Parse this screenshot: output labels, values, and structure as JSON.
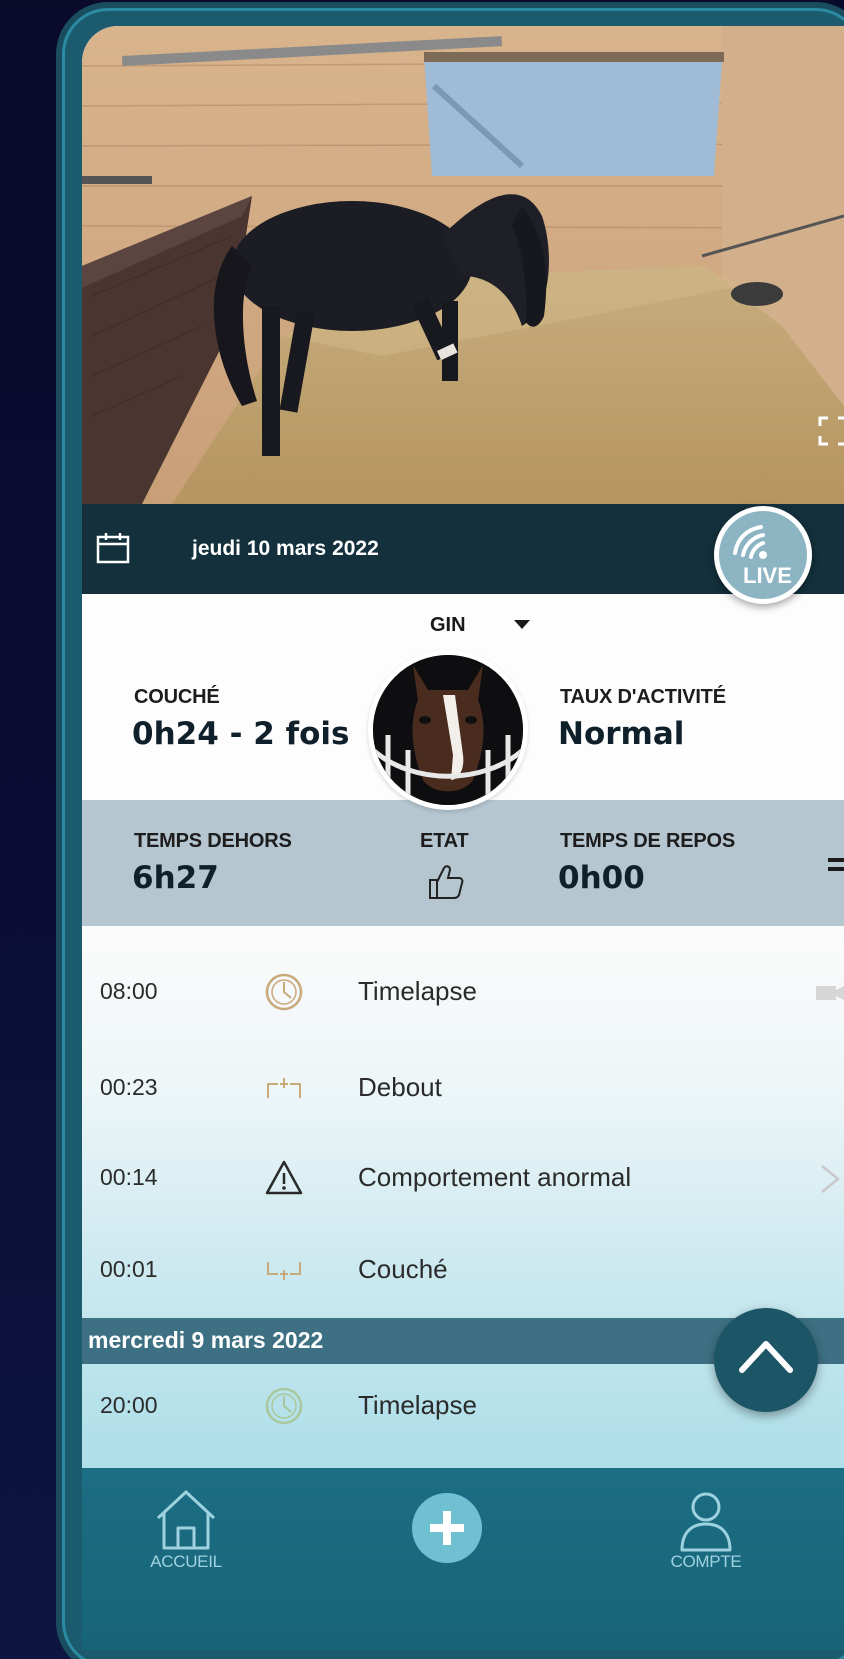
{
  "video": {
    "fullscreen_icon": "fullscreen-icon"
  },
  "date_bar": {
    "date": "jeudi 10 mars 2022",
    "calendar_icon": "calendar-icon"
  },
  "live_button": {
    "label": "LIVE",
    "icon": "wifi-icon"
  },
  "horse": {
    "name": "GIN",
    "lying": {
      "label": "COUCHÉ",
      "value": "0h24 - 2 fois"
    },
    "activity": {
      "label": "TAUX D'ACTIVITÉ",
      "value": "Normal"
    },
    "outside_time": {
      "label": "TEMPS DEHORS",
      "value": "6h27"
    },
    "state": {
      "label": "ETAT",
      "icon": "thumbs-up-icon"
    },
    "rest_time": {
      "label": "TEMPS DE REPOS",
      "value": "0h00"
    }
  },
  "timeline": {
    "today": [
      {
        "time": "08:00",
        "icon": "clock-icon",
        "label": "Timelapse"
      },
      {
        "time": "00:23",
        "icon": "standing-icon",
        "label": "Debout"
      },
      {
        "time": "00:14",
        "icon": "warning-icon",
        "label": "Comportement anormal"
      },
      {
        "time": "00:01",
        "icon": "lying-icon",
        "label": "Couché"
      }
    ],
    "previous_day": "mercredi 9 mars 2022",
    "previous": [
      {
        "time": "20:00",
        "icon": "clock-icon",
        "label": "Timelapse"
      }
    ]
  },
  "bottom_nav": {
    "home": "ACCUEIL",
    "account": "COMPTE"
  },
  "colors": {
    "date_bar": "#13303c",
    "stats_band": "#b5c6d1",
    "nav": "#1c6e84",
    "accent": "#6fc1d2"
  }
}
